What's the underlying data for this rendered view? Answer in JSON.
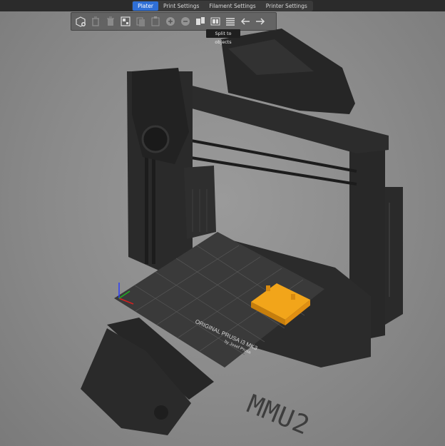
{
  "tabs": [
    {
      "label": "Plater",
      "active": true
    },
    {
      "label": "Print Settings",
      "active": false
    },
    {
      "label": "Filament Settings",
      "active": false
    },
    {
      "label": "Printer Settings",
      "active": false
    }
  ],
  "toolbar": {
    "buttons": [
      {
        "name": "add-object-icon",
        "enabled": true
      },
      {
        "name": "delete-icon",
        "enabled": false
      },
      {
        "name": "delete-all-icon",
        "enabled": false
      },
      {
        "name": "arrange-icon",
        "enabled": true
      },
      {
        "name": "copy-icon",
        "enabled": false
      },
      {
        "name": "paste-icon",
        "enabled": false
      },
      {
        "name": "add-instance-icon",
        "enabled": false
      },
      {
        "name": "remove-instance-icon",
        "enabled": false
      },
      {
        "name": "split-objects-icon",
        "enabled": true
      },
      {
        "name": "split-parts-icon",
        "enabled": true
      },
      {
        "name": "layers-editing-icon",
        "enabled": true
      },
      {
        "name": "undo-icon",
        "enabled": true
      },
      {
        "name": "redo-icon",
        "enabled": true
      }
    ]
  },
  "tooltip": {
    "text": "Split to objects"
  },
  "bed": {
    "line1": "ORIGINAL PRUSA i3 MK3",
    "line2": "by Josef Prusa"
  },
  "label": {
    "text": "MMU2"
  },
  "colors": {
    "accent": "#2f6fd6",
    "object": "#f2a51a",
    "printer": "#262626",
    "bed": "#3a3a3a"
  }
}
